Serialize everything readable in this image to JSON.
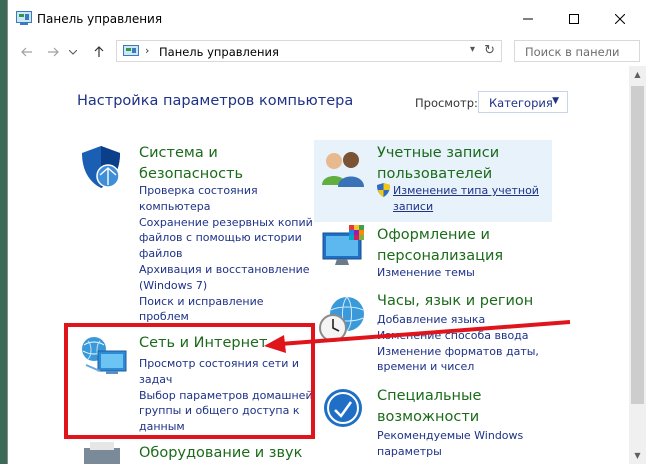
{
  "window": {
    "title": "Панель управления"
  },
  "address": {
    "path": "Панель управления",
    "separator": "›",
    "search_placeholder": "Поиск в панели"
  },
  "header": {
    "heading": "Настройка параметров компьютера",
    "view_label": "Просмотр:",
    "view_value": "Категория"
  },
  "categories": {
    "system": {
      "title_1": "Система и",
      "title_2": "безопасность",
      "links": [
        "Проверка состояния",
        "компьютера",
        "Сохранение резервных копий",
        "файлов с помощью истории",
        "файлов",
        "Архивация и восстановление",
        "(Windows 7)",
        "Поиск и исправление",
        "проблем"
      ]
    },
    "network": {
      "title": "Сеть и Интернет",
      "links": [
        "Просмотр состояния сети и",
        "задач",
        "Выбор параметров домашней",
        "группы и общего доступа к",
        "данным"
      ]
    },
    "hardware": {
      "title": "Оборудование и звук"
    },
    "accounts": {
      "title_1": "Учетные записи",
      "title_2": "пользователей",
      "links": [
        "Изменение типа учетной",
        "записи"
      ]
    },
    "appearance": {
      "title_1": "Оформление и",
      "title_2": "персонализация",
      "links": [
        "Изменение темы"
      ]
    },
    "clock": {
      "title": "Часы, язык и регион",
      "links": [
        "Добавление языка",
        "Изменение способа ввода",
        "Изменение форматов даты,",
        "времени и чисел"
      ]
    },
    "ease": {
      "title_1": "Специальные",
      "title_2": "возможности",
      "links": [
        "Рекомендуемые Windows",
        "параметры"
      ]
    }
  },
  "colors": {
    "annotation": "#e0151b",
    "link": "#1e3287",
    "category_title": "#1b6b1b"
  }
}
